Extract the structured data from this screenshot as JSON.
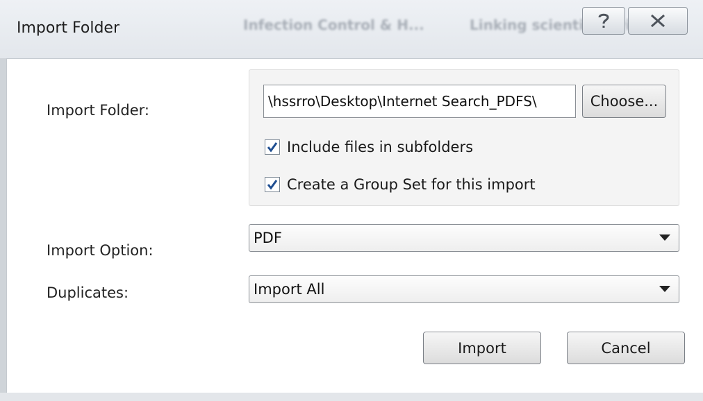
{
  "window": {
    "title": "Import Folder",
    "background_text": [
      "Infection Control & H...",
      "Linking scientific evidence"
    ],
    "help_icon": "question-mark-icon",
    "close_icon": "close-icon"
  },
  "form": {
    "import_folder_label": "Import Folder:",
    "folder_path": "\\hssrro\\Desktop\\Internet Search_PDFS\\",
    "choose_label": "Choose...",
    "include_subfolders": {
      "label": "Include files in subfolders",
      "checked": true
    },
    "create_group_set": {
      "label": "Create a Group Set for this import",
      "checked": true
    },
    "import_option_label": "Import Option:",
    "import_option_value": "PDF",
    "duplicates_label": "Duplicates:",
    "duplicates_value": "Import All"
  },
  "buttons": {
    "import_label": "Import",
    "cancel_label": "Cancel"
  },
  "colors": {
    "checkmark": "#1f4e91",
    "titlebar": "#e8ebef"
  }
}
